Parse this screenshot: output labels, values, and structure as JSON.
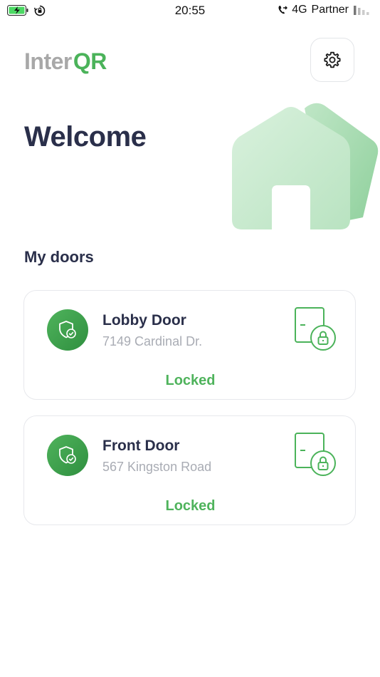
{
  "status_bar": {
    "time": "20:55",
    "network": "4G",
    "carrier": "Partner",
    "icons": [
      "battery-charging-icon",
      "rotation-lock-icon",
      "call-forward-icon",
      "signal-icon"
    ]
  },
  "header": {
    "logo_part1": "Inter",
    "logo_part2": "QR",
    "settings_icon": "gear-icon"
  },
  "main": {
    "welcome": "Welcome",
    "illustration": "house-icon",
    "section_title": "My doors",
    "doors": [
      {
        "name": "Lobby Door",
        "address": "7149 Cardinal Dr.",
        "status": "Locked",
        "status_icon": "shield-check-icon",
        "lock_icon": "door-lock-icon"
      },
      {
        "name": "Front Door",
        "address": "567 Kingston Road",
        "status": "Locked",
        "status_icon": "shield-check-icon",
        "lock_icon": "door-lock-icon"
      }
    ]
  },
  "colors": {
    "brand_green": "#4bb35a",
    "text_dark": "#2a2f4a",
    "text_muted": "#a9acb4"
  }
}
